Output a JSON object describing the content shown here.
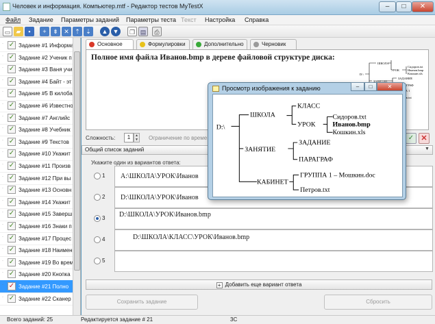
{
  "window": {
    "title": "Человек и информация. Компьютер.mtf - Редактор тестов MyTestX",
    "minimize": "–",
    "maximize": "□",
    "close": "✕"
  },
  "menu": [
    "Файл",
    "Задание",
    "Параметры заданий",
    "Параметры теста",
    "Текст",
    "Настройка",
    "Справка"
  ],
  "toolbar": {
    "icons": [
      "new-file-icon",
      "open-folder-icon",
      "save-icon",
      "add-task-icon",
      "add-task-after-icon",
      "delete-task-icon",
      "move-up-icon",
      "move-down-icon",
      "nav-up-icon",
      "nav-down-icon",
      "copy-icon",
      "paste-icon",
      "print-icon"
    ]
  },
  "sidebar": {
    "items": [
      {
        "label": "Задание #1 Информа",
        "checked": true,
        "selected": false
      },
      {
        "label": "Задание #2 Ученик п",
        "checked": true,
        "selected": false
      },
      {
        "label": "Задание #3 Ваня учи",
        "checked": true,
        "selected": false
      },
      {
        "label": "Задание #4 Байт - эт",
        "checked": true,
        "selected": false
      },
      {
        "label": "Задание #5 В килоба",
        "checked": true,
        "selected": false
      },
      {
        "label": "Задание #6 Известно",
        "checked": true,
        "selected": false
      },
      {
        "label": "Задание #7 Английс",
        "checked": true,
        "selected": false
      },
      {
        "label": "Задание #8 Учебник",
        "checked": true,
        "selected": false
      },
      {
        "label": "Задание #9 Текстов",
        "checked": true,
        "selected": false
      },
      {
        "label": "Задание #10 Укажит",
        "checked": true,
        "selected": false
      },
      {
        "label": "Задание #11 Произв",
        "checked": true,
        "selected": false
      },
      {
        "label": "Задание #12 При вы",
        "checked": true,
        "selected": false
      },
      {
        "label": "Задание #13 Основн",
        "checked": true,
        "selected": false
      },
      {
        "label": "Задание #14 Укажит",
        "checked": true,
        "selected": false
      },
      {
        "label": "Задание #15 Заверш",
        "checked": true,
        "selected": false
      },
      {
        "label": "Задание #16 Знаки п",
        "checked": true,
        "selected": false
      },
      {
        "label": "Задание #17 Процес",
        "checked": true,
        "selected": false
      },
      {
        "label": "Задание #18 Наимен",
        "checked": true,
        "selected": false
      },
      {
        "label": "Задание #19 Во врем",
        "checked": true,
        "selected": false
      },
      {
        "label": "Задание #20 Кнопка",
        "checked": true,
        "selected": false
      },
      {
        "label": "Задание #21 Полно",
        "checked": true,
        "selected": true
      },
      {
        "label": "Задание #22 Сканер",
        "checked": true,
        "selected": false
      }
    ]
  },
  "tabs": [
    {
      "label": "Основное",
      "color": "#d93a2a"
    },
    {
      "label": "Формулировки",
      "color": "#e8c21a"
    },
    {
      "label": "Дополнительно",
      "color": "#3aaa3a"
    },
    {
      "label": "Черновик",
      "color": "#9a9a9a"
    }
  ],
  "question": {
    "text": "Полное имя файла  Иванов.bmp в дереве файловой структуре диска:"
  },
  "difficulty": {
    "label": "Сложность:",
    "value": "1",
    "limit_label": "Ограничение по време"
  },
  "combo": {
    "value": "Общий список заданий"
  },
  "answers": {
    "hint": "Укажите один из вариантов ответа:",
    "options": [
      {
        "num": "1",
        "text": "А:\\ШКОЛА\\УРОК\\Иванов",
        "selected": false
      },
      {
        "num": "2",
        "text": "D:\\ШКОЛА\\УРОК\\Иванов",
        "selected": false
      },
      {
        "num": "3",
        "text": "D:\\ШКОЛА\\УРОК\\Иванов.bmp",
        "selected": true
      },
      {
        "num": "4",
        "text": "D:\\ШКОЛА\\КЛАСС\\УРОК\\Иванов.bmp",
        "selected": false
      },
      {
        "num": "5",
        "text": "",
        "selected": false
      }
    ],
    "add_label": "Добавить еще вариант ответа"
  },
  "buttons": {
    "save": "Сохранить задание",
    "reset": "Сбросить"
  },
  "status": {
    "total": "Всего заданий: 25",
    "editing": "Редактируется задание # 21",
    "code": "3C"
  },
  "dialog": {
    "title": "Просмотр изображения к заданию",
    "tree": {
      "root": "D:\\",
      "school": "ШКОЛА",
      "class": "КЛАСС",
      "lesson": "УРОК",
      "file1": "Сидоров.txt",
      "file2": "Иванов.bmp",
      "file3": "Кошкин.xls",
      "activity": "ЗАНЯТИЕ",
      "task": "ЗАДАНИЕ",
      "paragraph": "ПАРАГРАФ",
      "office": "КАБИНЕТ",
      "group": "ГРУППА 1 – Мошкин.doc",
      "file4": "Петров.txt"
    }
  },
  "thumbnail": {
    "labels": [
      "ШКОЛА",
      "УРОК",
      "D:\\",
      "ЗАНЯТИЕ",
      "КАБИНЕТ",
      "Иванов.bmp",
      "Сидоров.txt",
      "Кошкин.xls",
      "ЗАДАНИЕ",
      "ПАРАГРАФ",
      "ГРУППА 1",
      "Петров.txt"
    ]
  },
  "colors": {
    "titlebar": "#b9d7ec",
    "selection": "#3399ff",
    "desktop": "#5e9bbf"
  }
}
